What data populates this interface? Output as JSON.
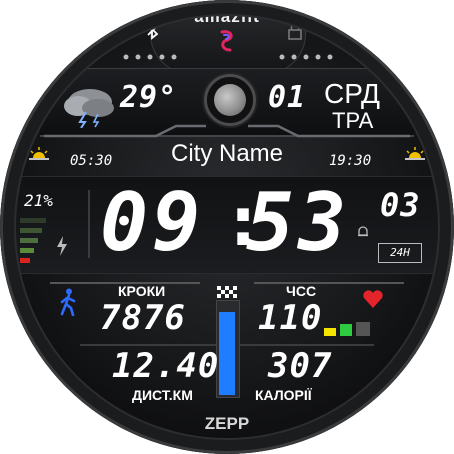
{
  "brand": {
    "logo_text": "amazfit",
    "bottom_text": "ZEPP"
  },
  "weather": {
    "temperature": "29°",
    "icon": "storm-cloud-icon"
  },
  "date": {
    "day": "01",
    "weekday": "СРД",
    "month": "ТРА"
  },
  "location": {
    "city": "City Name"
  },
  "sun": {
    "sunrise": "05:30",
    "sunset": "19:30"
  },
  "battery": {
    "percent": "21%",
    "level": 0.21
  },
  "time": {
    "hours": "09",
    "minutes": "53",
    "seconds": "03",
    "format": "24H"
  },
  "steps": {
    "label": "КРОКИ",
    "value": "7876"
  },
  "heart": {
    "label": "ЧСС",
    "value": "110"
  },
  "distance": {
    "label": "ДИСТ.КМ",
    "value": "12.40"
  },
  "calories": {
    "label": "КАЛОРІЇ",
    "value": "307"
  },
  "progress": {
    "level": 0.9
  },
  "colors": {
    "accent_blue": "#1f7dff",
    "heart_red": "#e3242b",
    "hr_yellow": "#f5e400",
    "hr_green": "#2ecc40",
    "battery_red": "#d8231e",
    "battery_green": "#5a8a3a"
  }
}
